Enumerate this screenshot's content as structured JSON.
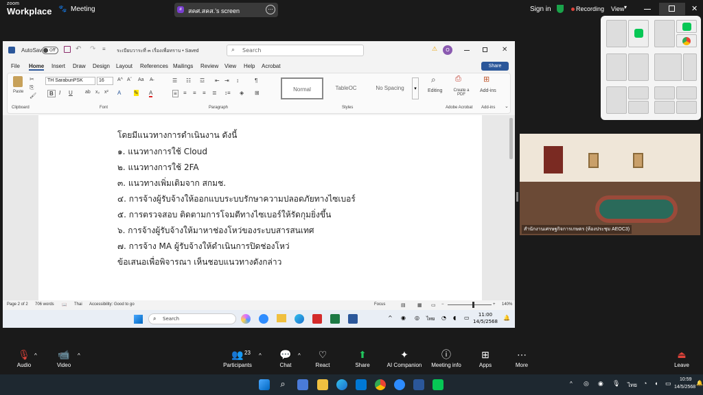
{
  "zoom": {
    "logo_top": "zoom",
    "logo_bottom": "Workplace",
    "meeting_label": "Meeting",
    "share_title": "สคศ.สคส.'s screen",
    "sign_in": "Sign in",
    "recording": "Recording",
    "view": "View",
    "toolbar": {
      "audio": "Audio",
      "video": "Video",
      "participants": "Participants",
      "participants_count": "23",
      "chat": "Chat",
      "react": "React",
      "share": "Share",
      "ai": "AI Companion",
      "meeting_info": "Meeting info",
      "apps": "Apps",
      "more": "More",
      "leave": "Leave"
    },
    "video_label": "สำนักงานเศรษฐกิจการเกษตร (ห้องประชุม AEOC3)"
  },
  "word": {
    "autosave": "AutoSave",
    "autosave_state": "Off",
    "doc_title": "ระเบียบวาระที่ ๓ เรื่องเพื่อทราบ • Saved",
    "search_placeholder": "Search",
    "menu": [
      "File",
      "Home",
      "Insert",
      "Draw",
      "Design",
      "Layout",
      "References",
      "Mailings",
      "Review",
      "View",
      "Help",
      "Acrobat"
    ],
    "share_btn": "Share",
    "ribbon": {
      "paste": "Paste",
      "clipboard": "Clipboard",
      "font_name": "TH SarabunPSK",
      "font_size": "16",
      "font": "Font",
      "paragraph": "Paragraph",
      "styles": [
        "Normal",
        "TableOC",
        "No Spacing"
      ],
      "styles_label": "Styles",
      "editing": "Editing",
      "create_pdf": "Create a PDF",
      "adobe": "Adobe Acrobat",
      "addins": "Add-ins",
      "addins_group": "Add-ins"
    },
    "doc_lines": [
      "โดยมีแนวทางการดำเนินงาน ดังนี้",
      "๑.  แนวทางการใช้ Cloud",
      "๒.  แนวทางการใช้ 2FA",
      "๓.  แนวทางเพิ่มเติมจาก สกมช.",
      "๔.  การจ้างผู้รับจ้างให้ออกแบบระบบรักษาความปลอดภัยทางไซเบอร์",
      "๕.  การตรวจสอบ ติดตามการโจมตีทางไซเบอร์ให้รัดกุมยิ่งขึ้น",
      "๖.  การจ้างผู้รับจ้างให้มาหาช่องโหว่ของระบบสารสนเทศ",
      "๗.  การจ้าง MA ผู้รับจ้างให้ดำเนินการปิดช่องโหว่",
      "ข้อเสนอเพื่อพิจารณา เห็นชอบแนวทางดังกล่าว"
    ],
    "status": {
      "page": "Page 2 of 2",
      "words": "706 words",
      "lang": "Thai",
      "accessibility": "Accessibility: Good to go",
      "focus": "Focus",
      "zoom": "140%"
    },
    "taskbar": {
      "search": "Search",
      "time": "11:00",
      "date": "14/5/2568",
      "lang": "ไทย"
    }
  },
  "os": {
    "time": "10:59",
    "date": "14/5/2568",
    "lang": "ไทย"
  },
  "colors": {
    "word_blue": "#2b579a",
    "recording_red": "#e0433a",
    "shield_green": "#1aa34a"
  }
}
